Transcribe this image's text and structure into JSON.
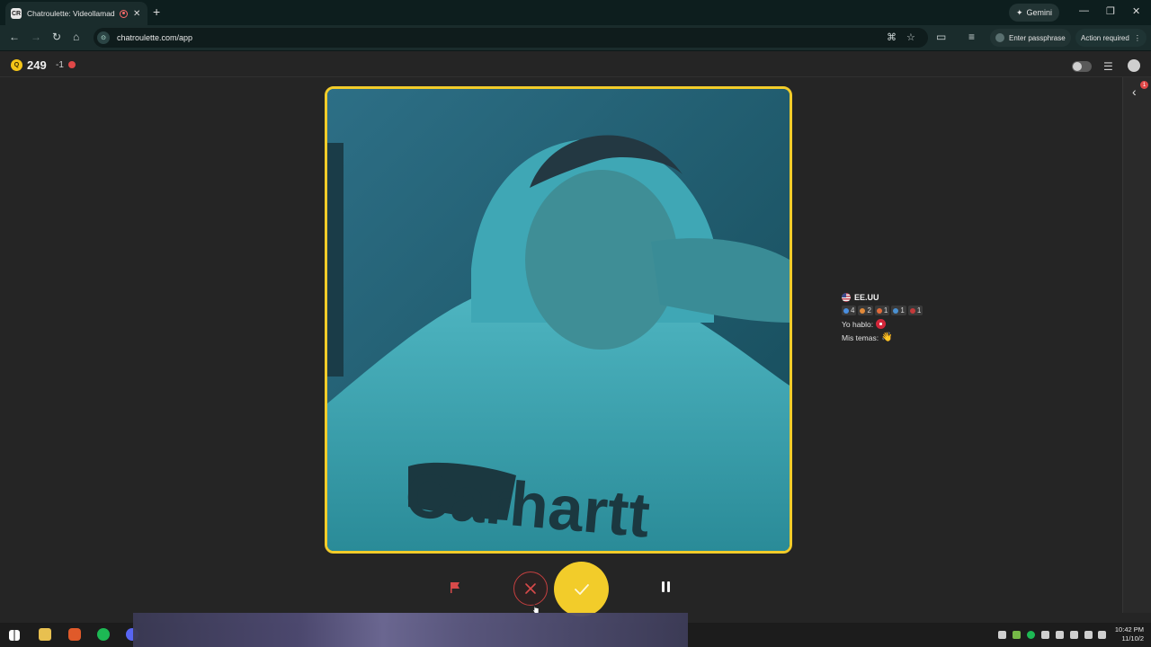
{
  "browser": {
    "tab_title": "Chatroulette: Videollamad",
    "tab_favicon_text": "CR",
    "gemini_label": "Gemini",
    "url": "chatroulette.com/app",
    "passphrase_label": "Enter passphrase",
    "action_label": "Action required"
  },
  "app": {
    "coins": "249",
    "coin_delta": "-1",
    "coin_symbol": "Q"
  },
  "partner": {
    "country": "EE.UU",
    "stats": [
      {
        "icon": "heart-icon",
        "value": "4",
        "color": "#4a8fe0"
      },
      {
        "icon": "gift-icon",
        "value": "2",
        "color": "#e08a3a"
      },
      {
        "icon": "shield-icon",
        "value": "1",
        "color": "#e06a3a"
      },
      {
        "icon": "star-icon",
        "value": "1",
        "color": "#4a90d0"
      },
      {
        "icon": "ban-icon",
        "value": "1",
        "color": "#c33a3a"
      }
    ],
    "speaks_label": "Yo hablo:",
    "topics_label": "Mis temas:",
    "topics_emoji": "👋"
  },
  "notifications": {
    "panel_badge": "1"
  },
  "clock": {
    "time": "10:42 PM",
    "date": "11/10/2"
  },
  "colors": {
    "accent": "#f2cc2a",
    "danger": "#c43f3f",
    "background": "#252525"
  }
}
